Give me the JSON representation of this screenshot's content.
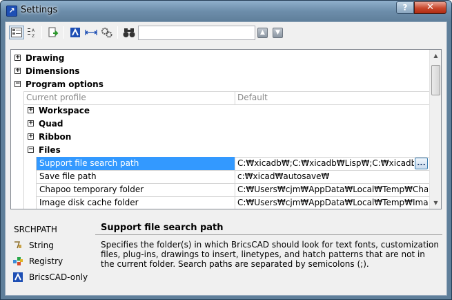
{
  "window": {
    "title": "Settings",
    "help_label": "?",
    "close_label": "✕"
  },
  "toolbar": {
    "search_value": "",
    "search_placeholder": "",
    "icons": [
      "categorized-view-icon",
      "alphabetic-sort-icon",
      "export-icon",
      "bricscad-filter-icon",
      "dimension-filter-icon",
      "settings-filter-icon",
      "find-binoculars-icon",
      "previous-arrow-icon",
      "next-arrow-icon"
    ]
  },
  "tree": {
    "nodes": [
      {
        "label": "Drawing",
        "expander": "+"
      },
      {
        "label": "Dimensions",
        "expander": "+"
      },
      {
        "label": "Program options",
        "expander": "−"
      }
    ],
    "header": {
      "name": "Current profile",
      "value": "Default"
    },
    "subnodes": [
      {
        "label": "Workspace",
        "expander": "+"
      },
      {
        "label": "Quad",
        "expander": "+"
      },
      {
        "label": "Ribbon",
        "expander": "+"
      },
      {
        "label": "Files",
        "expander": "−"
      }
    ],
    "rows": [
      {
        "name": "Support file search path",
        "value": "C:₩xicadb₩;C:₩xicadb₩Lisp₩;C:₩xicadb₩Lib₩",
        "selected": true
      },
      {
        "name": "Save file path",
        "value": "c:₩xicad₩autosave₩",
        "selected": false
      },
      {
        "name": "Chapoo temporary folder",
        "value": "C:₩Users₩cjm₩AppData₩Local₩Temp₩Chapoo₩",
        "selected": false
      },
      {
        "name": "Image disk cache folder",
        "value": "C:₩Users₩cjm₩AppData₩Local₩Temp₩ImageCache₩",
        "selected": false
      }
    ],
    "browse_label": "..."
  },
  "bottom": {
    "variable": "SRCHPATH",
    "props": [
      {
        "label": "String",
        "icon": "string-type-icon"
      },
      {
        "label": "Registry",
        "icon": "registry-icon"
      },
      {
        "label": "BricsCAD-only",
        "icon": "bricscad-icon"
      }
    ],
    "description_title": "Support file search path",
    "description": "Specifies the folder(s) in which BricsCAD should look for text fonts, customization files, plug-ins, drawings to insert, linetypes, and hatch patterns that are not in the current folder. Search paths are separated by semicolons (;)."
  },
  "colors": {
    "selection": "#3399ff",
    "titlebar": "#6d8eab",
    "close": "#c8472c"
  }
}
